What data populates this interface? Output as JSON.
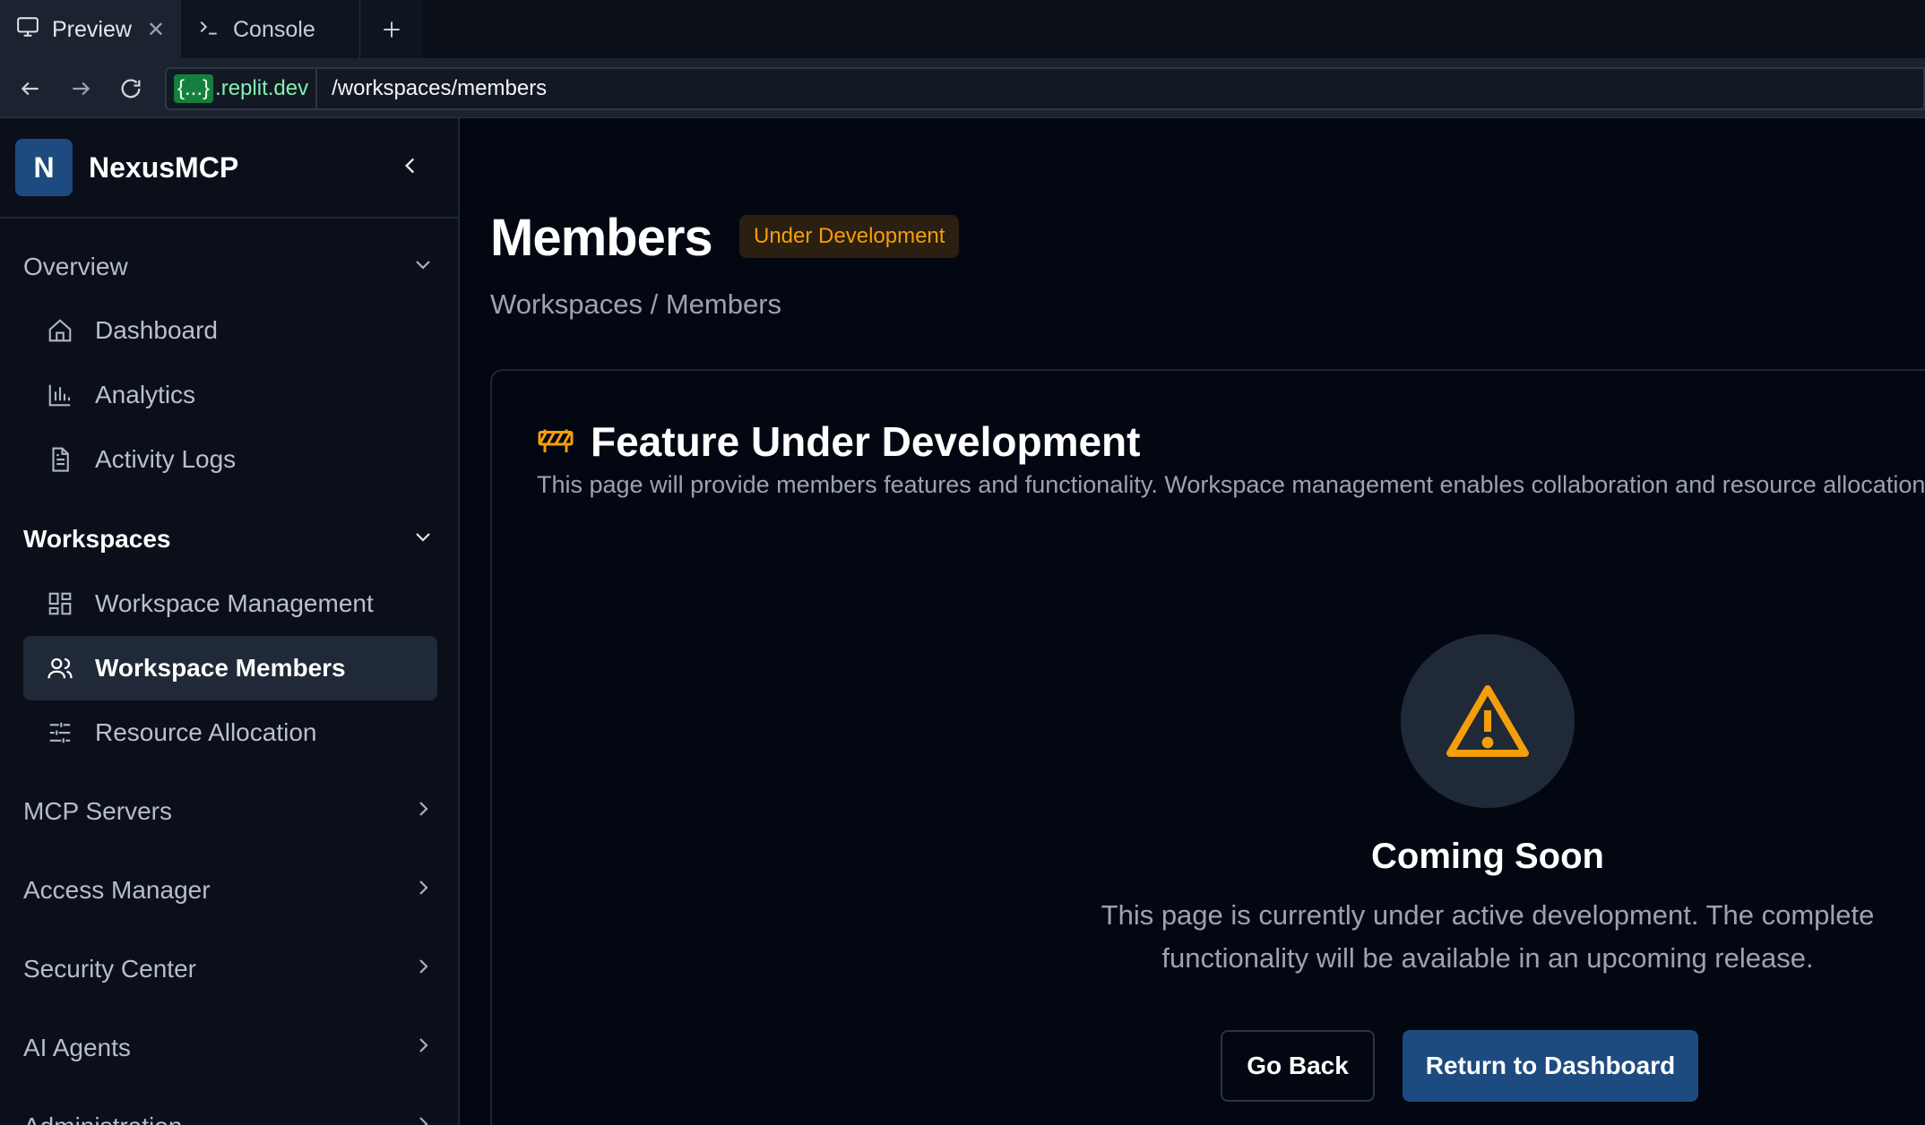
{
  "browser": {
    "tabs": [
      {
        "label": "Preview",
        "icon": "monitor-icon",
        "active": true
      },
      {
        "label": "Console",
        "icon": "terminal-icon",
        "active": false
      }
    ],
    "url_host_highlight": "{...}",
    "url_host": ".replit.dev",
    "url_path": "/workspaces/members"
  },
  "sidebar": {
    "logo_letter": "N",
    "brand": "NexusMCP",
    "sections": [
      {
        "label": "Overview",
        "expanded": true,
        "items": [
          {
            "label": "Dashboard",
            "icon": "home-icon"
          },
          {
            "label": "Analytics",
            "icon": "bar-chart-icon"
          },
          {
            "label": "Activity Logs",
            "icon": "document-icon"
          }
        ]
      },
      {
        "label": "Workspaces",
        "expanded": true,
        "items": [
          {
            "label": "Workspace Management",
            "icon": "grid-icon"
          },
          {
            "label": "Workspace Members",
            "icon": "users-icon",
            "active": true
          },
          {
            "label": "Resource Allocation",
            "icon": "sliders-icon"
          }
        ]
      },
      {
        "label": "MCP Servers",
        "expanded": false
      },
      {
        "label": "Access Manager",
        "expanded": false
      },
      {
        "label": "Security Center",
        "expanded": false
      },
      {
        "label": "AI Agents",
        "expanded": false
      },
      {
        "label": "Administration",
        "expanded": false
      }
    ]
  },
  "main": {
    "title": "Members",
    "badge": "Under Development",
    "breadcrumb": "Workspaces / Members",
    "card": {
      "title": "Feature Under Development",
      "description": "This page will provide members features and functionality. Workspace management enables collaboration and resource allocation.",
      "coming_title": "Coming Soon",
      "coming_line1": "This page is currently under active development. The complete",
      "coming_line2": "functionality will be available in an upcoming release.",
      "back_label": "Go Back",
      "primary_label": "Return to Dashboard"
    }
  },
  "colors": {
    "accent": "#1e4b7f",
    "warning": "#f59e0b",
    "background": "#030712",
    "sidebar": "#0a0f1a"
  }
}
